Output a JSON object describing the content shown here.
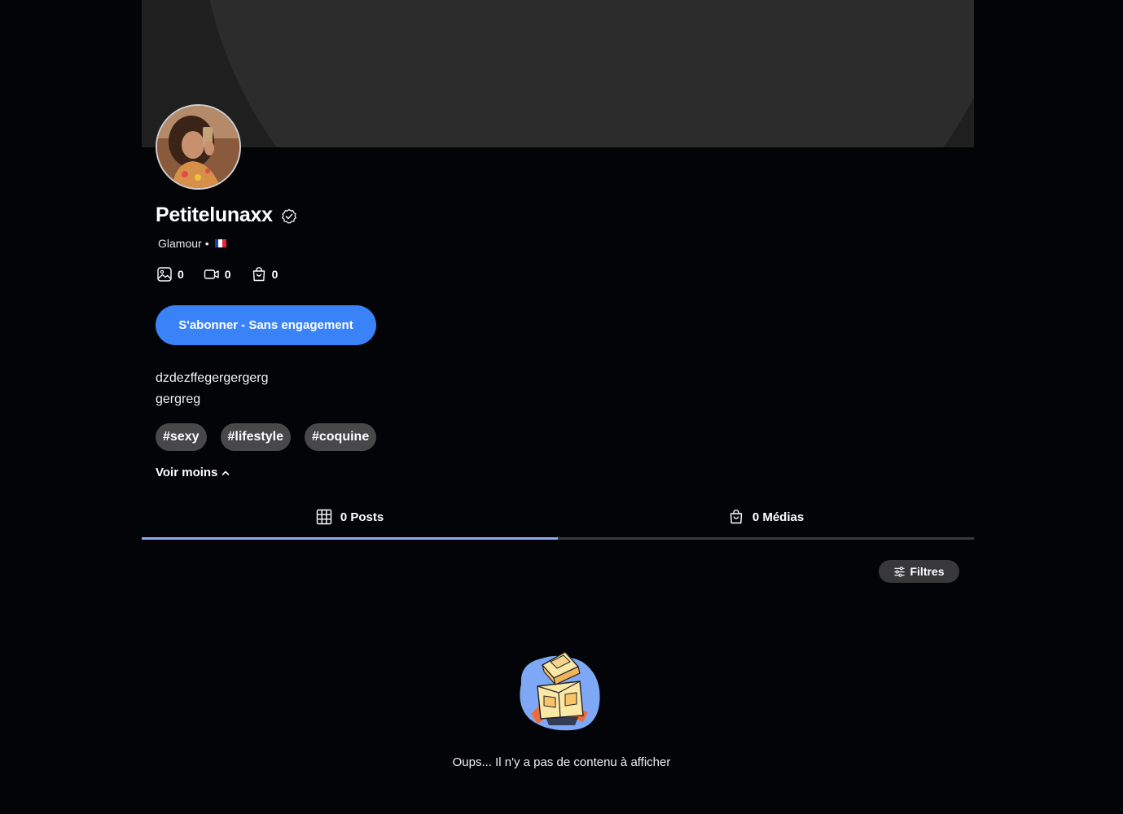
{
  "profile": {
    "name": "Petitelunaxx",
    "category": "Glamour",
    "separator": "•",
    "flag_colors": [
      "#1f3fb0",
      "#ffffff",
      "#e0263a"
    ]
  },
  "stats": [
    {
      "icon": "image-icon",
      "value": "0"
    },
    {
      "icon": "video-icon",
      "value": "0"
    },
    {
      "icon": "shopping-bag-icon",
      "value": "0"
    }
  ],
  "subscribe": {
    "label": "S'abonner - Sans engagement"
  },
  "bio": {
    "line1": "dzdezffegergergerg",
    "line2": "gergreg"
  },
  "tags": [
    "#sexy",
    "#lifestyle",
    "#coquine"
  ],
  "voir_moins": {
    "label": "Voir moins"
  },
  "tabs": [
    {
      "label": "0 Posts",
      "icon": "grid-icon",
      "active": true
    },
    {
      "label": "0 Médias",
      "icon": "shopping-bag-icon",
      "active": false
    }
  ],
  "filters": {
    "label": "Filtres"
  },
  "empty": {
    "message": "Oups... Il n'y a pas de contenu à afficher"
  },
  "colors": {
    "accent": "#3a82f7",
    "tab_active": "#8aaaf2",
    "background": "#030408"
  }
}
